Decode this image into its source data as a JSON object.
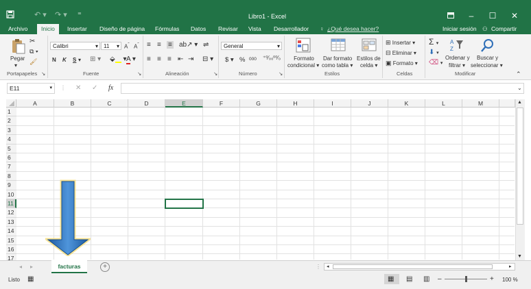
{
  "window": {
    "title": "Libro1 - Excel",
    "minimize": "–",
    "maximize": "☐",
    "close": "✕"
  },
  "colors": {
    "accent": "#217346",
    "selection": "#217346",
    "arrow": "#2f6fb8"
  },
  "tabs": [
    {
      "label": "Archivo"
    },
    {
      "label": "Inicio"
    },
    {
      "label": "Insertar"
    },
    {
      "label": "Diseño de página"
    },
    {
      "label": "Fórmulas"
    },
    {
      "label": "Datos"
    },
    {
      "label": "Revisar"
    },
    {
      "label": "Vista"
    },
    {
      "label": "Desarrollador"
    }
  ],
  "tellme": "¿Qué desea hacer?",
  "signin": "Iniciar sesión",
  "share": "Compartir",
  "ribbon": {
    "clipboard": {
      "paste": "Pegar",
      "group": "Portapapeles"
    },
    "font": {
      "name": "Calibri",
      "size": "11",
      "bold": "N",
      "italic": "K",
      "underline": "S",
      "group": "Fuente"
    },
    "alignment": {
      "group": "Alineación"
    },
    "number": {
      "format": "General",
      "currency": "$",
      "percent": "%",
      "thousands": "000",
      "group": "Número"
    },
    "styles": {
      "cond1": "Formato",
      "cond2": "condicional",
      "table1": "Dar formato",
      "table2": "como tabla",
      "cell1": "Estilos de",
      "cell2": "celda",
      "group": "Estilos"
    },
    "cells": {
      "insert": "Insertar",
      "delete": "Eliminar",
      "format": "Formato",
      "group": "Celdas"
    },
    "editing": {
      "sort1": "Ordenar y",
      "sort2": "filtrar",
      "find1": "Buscar y",
      "find2": "seleccionar",
      "group": "Modificar"
    }
  },
  "formula_bar": {
    "name_box": "E11",
    "fx": "fx",
    "value": ""
  },
  "columns": [
    "A",
    "B",
    "C",
    "D",
    "E",
    "F",
    "G",
    "H",
    "I",
    "J",
    "K",
    "L",
    "M"
  ],
  "rows": [
    "1",
    "2",
    "3",
    "4",
    "5",
    "6",
    "7",
    "8",
    "9",
    "10",
    "11",
    "12",
    "13",
    "14",
    "15",
    "16",
    "17"
  ],
  "active_cell": "E11",
  "sheet_tab": "facturas",
  "add_sheet": "+",
  "status": {
    "ready": "Listo",
    "zoom": "100 %"
  }
}
